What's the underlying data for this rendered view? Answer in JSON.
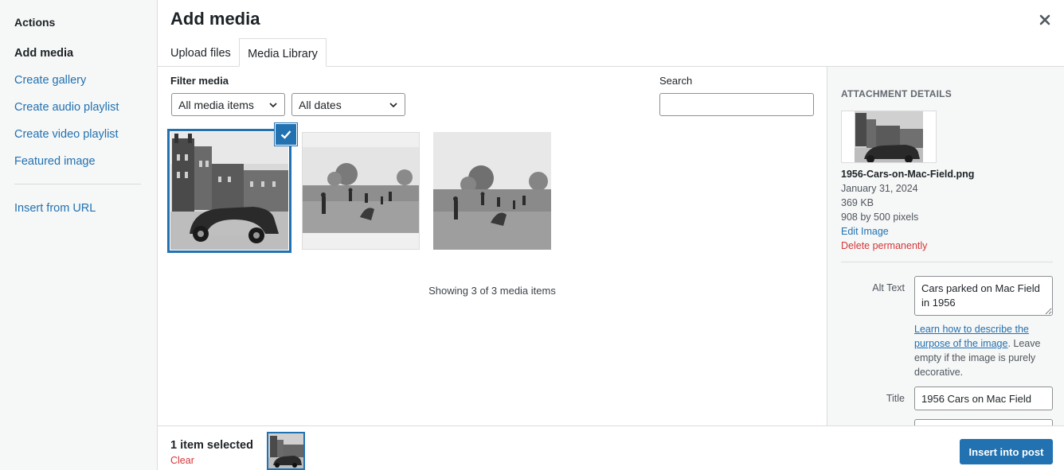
{
  "menu": {
    "heading": "Actions",
    "items": [
      {
        "label": "Add media",
        "active": true
      },
      {
        "label": "Create gallery"
      },
      {
        "label": "Create audio playlist"
      },
      {
        "label": "Create video playlist"
      },
      {
        "label": "Featured image"
      },
      {
        "label": "Insert from URL"
      }
    ]
  },
  "frame": {
    "title": "Add media",
    "close_icon": "close-icon",
    "tabs": [
      {
        "label": "Upload files"
      },
      {
        "label": "Media Library",
        "active": true
      }
    ]
  },
  "toolbar": {
    "filter_label": "Filter media",
    "type_filter": {
      "selected": "All media items"
    },
    "date_filter": {
      "selected": "All dates"
    },
    "search_label": "Search",
    "search_value": ""
  },
  "library": {
    "items": [
      {
        "name": "thumbnail-1",
        "selected": true
      },
      {
        "name": "thumbnail-2"
      },
      {
        "name": "thumbnail-3"
      }
    ],
    "status": "Showing 3 of 3 media items"
  },
  "attachment": {
    "heading": "Attachment Details",
    "filename": "1956-Cars-on-Mac-Field.png",
    "date": "January 31, 2024",
    "size": "369 KB",
    "dimensions": "908 by 500 pixels",
    "edit_label": "Edit Image",
    "delete_label": "Delete permanently",
    "alt_label": "Alt Text",
    "alt_value": "Cars parked on Mac Field in 1956",
    "alt_help_link": "Learn how to describe the purpose of the image",
    "alt_help_rest": ". Leave empty if the image is purely decorative.",
    "title_label": "Title",
    "title_value": "1956 Cars on Mac Field"
  },
  "bottom": {
    "selected_count": "1 item selected",
    "clear_label": "Clear",
    "insert_label": "Insert into post"
  },
  "colors": {
    "accent": "#2271b1",
    "danger": "#d63638",
    "panel_bg": "#f6f7f7",
    "border": "#dcdcde"
  }
}
